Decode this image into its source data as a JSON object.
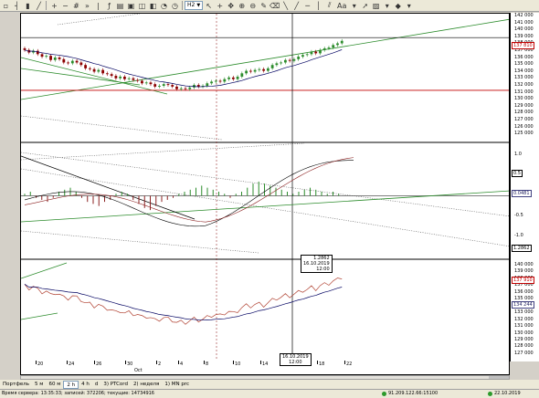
{
  "toolbar": {
    "timeframe": "H2",
    "font_button": "Aa",
    "icons": [
      "new-chart-icon",
      "open-icon",
      "save-icon",
      "print-icon",
      "cut-icon",
      "copy-icon",
      "paste-icon",
      "refresh-icon",
      "zoom-in-icon",
      "zoom-out-icon",
      "chart-bars-icon",
      "chart-candles-icon",
      "chart-line-icon",
      "timeframe-combo",
      "crosshair-icon",
      "move-icon",
      "zoom-rect-icon",
      "zoom-out-icon",
      "hand-icon",
      "pencil-icon",
      "eraser-icon",
      "line-icon",
      "ray-icon",
      "channel-icon",
      "font-icon",
      "fill-icon",
      "arrow-icon",
      "undo-icon",
      "redo-icon",
      "settings-icon"
    ]
  },
  "price_axis": {
    "labels": [
      "142 000",
      "141 000",
      "140 000",
      "139 000",
      "138 000",
      "137 000",
      "136 000",
      "135 000",
      "134 000",
      "133 000",
      "132 000",
      "131 000",
      "130 000",
      "129 000",
      "128 000",
      "127 000",
      "126 000",
      "125 000"
    ],
    "last_price_tag": "137 810"
  },
  "oscillator_axis": {
    "labels": [
      "1.0",
      "0.5",
      "0.0",
      "-0.5",
      "-1.0"
    ],
    "tag_top": "0.5",
    "tag_mid": "0.0481",
    "tag_bottom": "1.2862"
  },
  "lower_axis": {
    "labels": [
      "140 000",
      "139 000",
      "138 000",
      "137 000",
      "136 000",
      "135 000",
      "134 000",
      "133 000",
      "132 000",
      "131 000",
      "130 000",
      "129 000",
      "128 000",
      "127 000"
    ],
    "tag_red": "137 910",
    "tag_blue": "134 244"
  },
  "crosshair": {
    "value": "1.2862",
    "date": "16.10.2019",
    "time": "12:00",
    "time_axis_label": "16.10.2019",
    "time_axis_label2": "12:00"
  },
  "date_axis": {
    "days": [
      "20",
      "24",
      "26",
      "30",
      "2",
      "4",
      "8",
      "10",
      "14",
      "18",
      "22"
    ],
    "month": "Oct"
  },
  "timeframes": [
    "Портфель",
    "5 м",
    "60 м",
    "2 h",
    "4 h",
    "d",
    "3) PTCord",
    "2) неделя",
    "1) MN prc"
  ],
  "active_timeframe_index": 3,
  "status": {
    "server_info": "Время сервера: 13:35:33; записей: 372206; текущие: 14734916",
    "server_address": "91.209.122.66:15100",
    "date": "22.10.2019"
  },
  "colors": {
    "bull_candle": "#2c8c2c",
    "bear_candle": "#8b0000",
    "price_line": "#b04030",
    "ma_line": "#000060",
    "trend_line": "#2c8c2c",
    "hline": "#c00000"
  }
}
